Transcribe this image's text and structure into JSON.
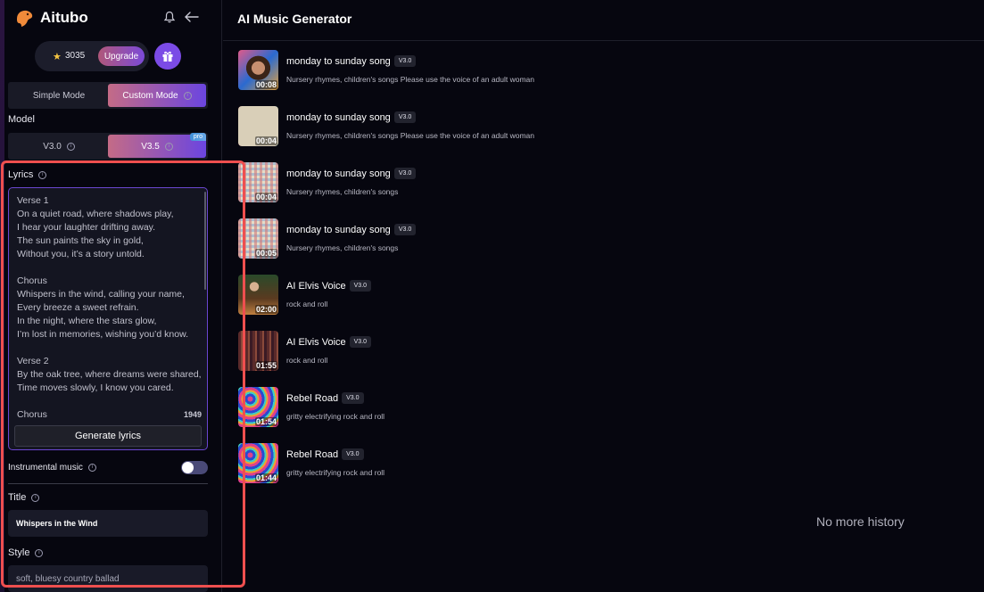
{
  "sidebar": {
    "brand": "Aitubo",
    "credits": "3035",
    "upgrade_label": "Upgrade",
    "modes": [
      {
        "label": "Simple Mode",
        "active": false
      },
      {
        "label": "Custom Mode",
        "active": true
      }
    ],
    "model_label": "Model",
    "models": [
      {
        "label": "V3.0",
        "active": false
      },
      {
        "label": "V3.5",
        "active": true,
        "badge": "pro"
      }
    ],
    "lyrics_label": "Lyrics",
    "lyrics_value": "Verse 1\nOn a quiet road, where shadows play,\nI hear your laughter drifting away.\nThe sun paints the sky in gold,\nWithout you, it’s a story untold.\n\nChorus\nWhispers in the wind, calling your name,\nEvery breeze a sweet refrain.\nIn the night, where the stars glow,\nI’m lost in memories, wishing you’d know.\n\nVerse 2\nBy the oak tree, where dreams were shared,\nTime moves slowly, I know you cared.\n\nChorus",
    "char_count": "1949",
    "generate_lyrics_label": "Generate lyrics",
    "instrumental_label": "Instrumental music",
    "instrumental_on": false,
    "title_label": "Title",
    "title_value": "Whispers in the Wind",
    "style_label": "Style",
    "style_value": "soft, bluesy country ballad"
  },
  "main": {
    "title": "AI Music Generator",
    "songs": [
      {
        "title": "monday to sunday song",
        "version": "V3.0",
        "desc": "Nursery rhymes, children's songs Please use the voice of an adult woman",
        "duration": "00:08",
        "thumb": "portrait"
      },
      {
        "title": "monday to sunday song",
        "version": "V3.0",
        "desc": "Nursery rhymes, children's songs Please use the voice of an adult woman",
        "duration": "00:04",
        "thumb": "calendar"
      },
      {
        "title": "monday to sunday song",
        "version": "V3.0",
        "desc": "Nursery rhymes, children's songs",
        "duration": "00:04",
        "thumb": "grid"
      },
      {
        "title": "monday to sunday song",
        "version": "V3.0",
        "desc": "Nursery rhymes, children's songs",
        "duration": "00:05",
        "thumb": "grid"
      },
      {
        "title": "AI Elvis Voice",
        "version": "V3.0",
        "desc": "rock and roll",
        "duration": "02:00",
        "thumb": "guitarist"
      },
      {
        "title": "AI Elvis Voice",
        "version": "V3.0",
        "desc": "rock and roll",
        "duration": "01:55",
        "thumb": "forest"
      },
      {
        "title": "Rebel Road",
        "version": "V3.0",
        "desc": "gritty electrifying rock and roll",
        "duration": "01:54",
        "thumb": "psychedelic"
      },
      {
        "title": "Rebel Road",
        "version": "V3.0",
        "desc": "gritty electrifying rock and roll",
        "duration": "01:44",
        "thumb": "psychedelic"
      }
    ],
    "no_more_label": "No more history"
  }
}
